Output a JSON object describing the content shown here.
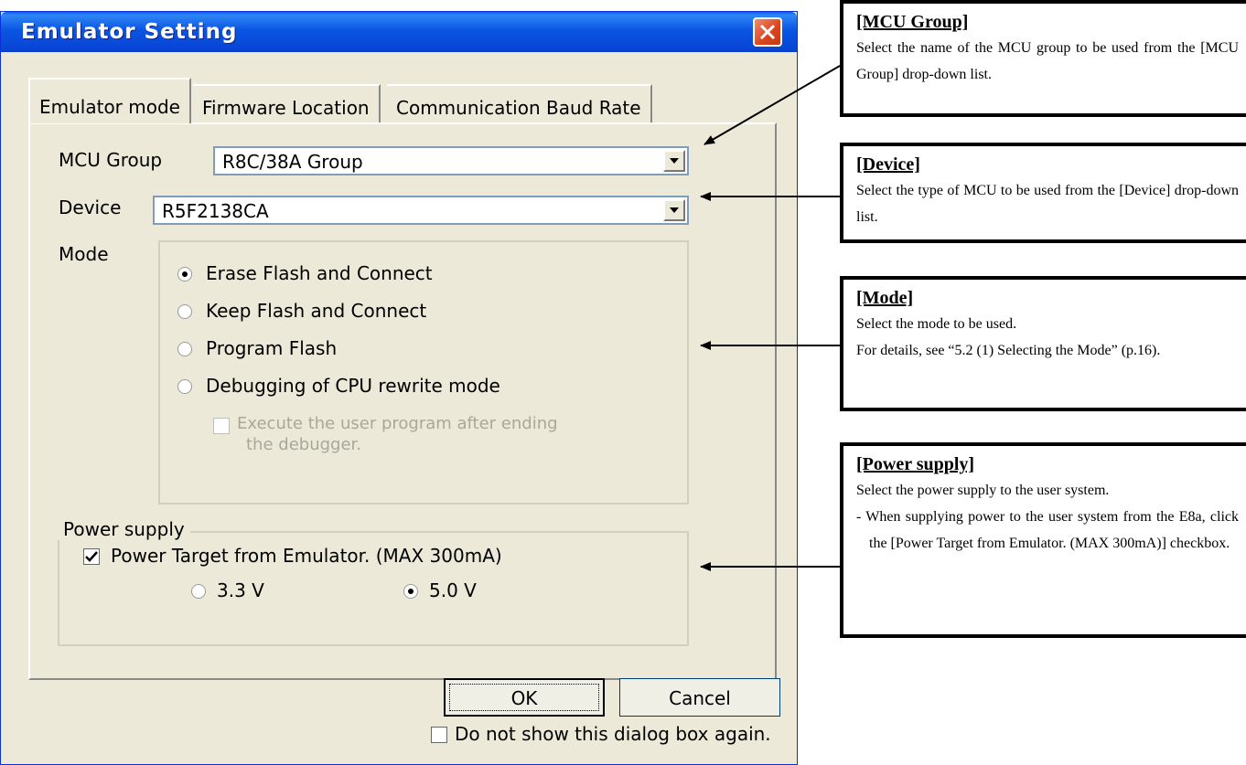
{
  "dialog": {
    "title": "Emulator Setting",
    "tabs": [
      "Emulator mode",
      "Firmware Location",
      "Communication Baud Rate"
    ],
    "mcu_group": {
      "label": "MCU Group",
      "value": "R8C/38A Group"
    },
    "device": {
      "label": "Device",
      "value": "R5F2138CA"
    },
    "mode": {
      "label": "Mode",
      "options": [
        {
          "text": "Erase Flash and Connect",
          "selected": true
        },
        {
          "text": "Keep Flash and Connect",
          "selected": false
        },
        {
          "text": "Program Flash",
          "selected": false
        },
        {
          "text": "Debugging of CPU rewrite mode",
          "selected": false
        }
      ],
      "execute_checkbox": {
        "line1": "Execute the user program after ending",
        "line2": "the debugger.",
        "checked": false,
        "enabled": false
      }
    },
    "power_supply": {
      "label": "Power supply",
      "checkbox": {
        "text": "Power Target from Emulator. (MAX 300mA)",
        "checked": true
      },
      "options": [
        {
          "text": "3.3 V",
          "selected": false
        },
        {
          "text": "5.0 V",
          "selected": true
        }
      ]
    },
    "ok_label": "OK",
    "cancel_label": "Cancel",
    "dont_show": {
      "text": "Do not show this dialog box again.",
      "checked": false
    }
  },
  "annotations": [
    {
      "title": "[MCU Group]",
      "lines": [
        "Select the name of the MCU group to be used from the [MCU Group] drop-down list."
      ]
    },
    {
      "title": "[Device]",
      "lines": [
        "Select the type of MCU to be used from the [Device] drop-down list."
      ]
    },
    {
      "title": "[Mode]",
      "lines": [
        "Select the mode to be used.",
        "For details, see “5.2 (1) Selecting the Mode” (p.16)."
      ]
    },
    {
      "title": "[Power supply]",
      "lines": [
        "Select the power supply to the user system.",
        "- When supplying power to the user system from the E8a, click the [Power Target from Emulator. (MAX 300mA)] checkbox."
      ]
    }
  ]
}
